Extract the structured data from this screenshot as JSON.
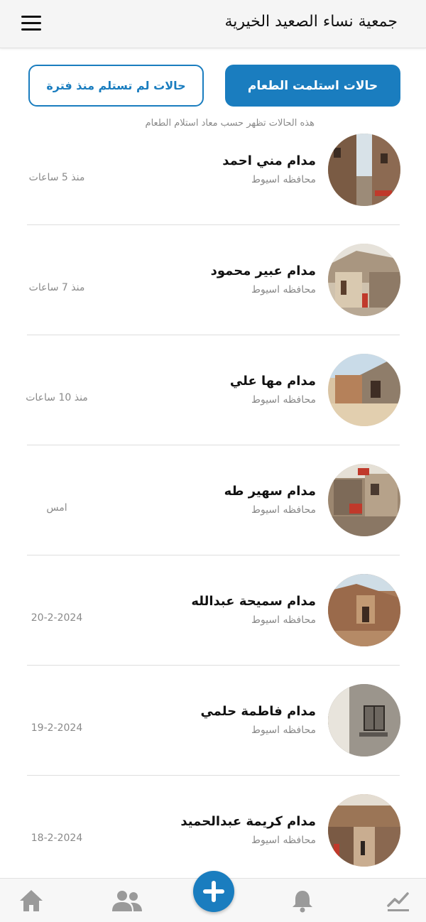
{
  "header": {
    "title": "جمعية نساء الصعيد الخيرية",
    "menu_icon": "hamburger-menu-icon"
  },
  "filters": {
    "received_label": "حالات استلمت الطعام",
    "not_received_label": "حالات لم تستلم منذ فترة",
    "hint": "هذه الحالات تظهر حسب معاد استلام الطعام"
  },
  "cases": [
    {
      "name": "مدام مني احمد",
      "location": "محافظه اسيوط",
      "time": "منذ 5 ساعات"
    },
    {
      "name": "مدام عبير محمود",
      "location": "محافظه اسيوط",
      "time": "منذ 7 ساعات"
    },
    {
      "name": "مدام مها علي",
      "location": "محافظه اسيوط",
      "time": "منذ 10 ساعات"
    },
    {
      "name": "مدام سهير طه",
      "location": "محافظه اسيوط",
      "time": "امس"
    },
    {
      "name": "مدام سميحة عبدالله",
      "location": "محافظه اسيوط",
      "time": "20-2-2024"
    },
    {
      "name": "مدام فاطمة حلمي",
      "location": "محافظه اسيوط",
      "time": "19-2-2024"
    },
    {
      "name": "مدام كريمة عبدالحميد",
      "location": "محافظه اسيوط",
      "time": "18-2-2024"
    }
  ],
  "bottom_nav": {
    "items": [
      "home-icon",
      "people-icon",
      "add-icon",
      "bell-icon",
      "chart-icon"
    ]
  },
  "colors": {
    "accent": "#1a7dbf",
    "nav_icon": "#9a9a9a"
  }
}
